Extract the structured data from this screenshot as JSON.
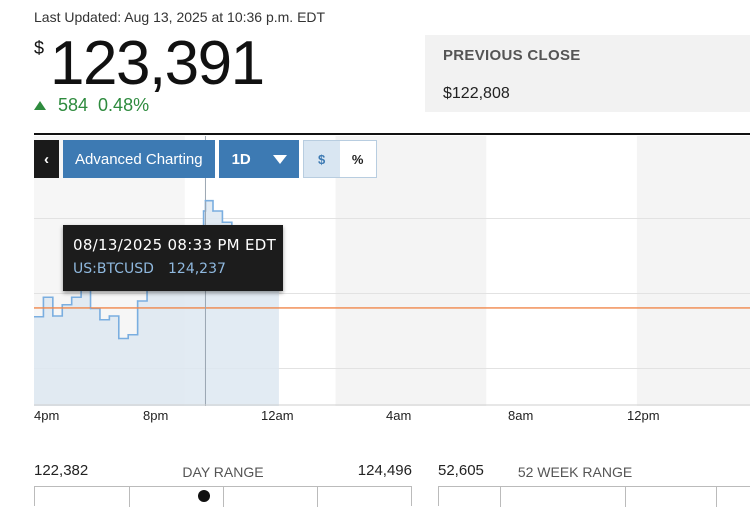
{
  "header": {
    "last_updated": "Last Updated: Aug 13, 2025 at 10:36 p.m. EDT",
    "currency_symbol": "$",
    "price": "123,391",
    "change": "584",
    "change_percent": "0.48%",
    "change_direction": "up",
    "change_color": "#2e8b3e"
  },
  "previous_close": {
    "label": "PREVIOUS CLOSE",
    "value": "$122,808"
  },
  "toolbar": {
    "back_icon": "chevron-left-icon",
    "back_glyph": "‹",
    "advanced_label": "Advanced Charting",
    "range_label": "1D",
    "dollar_label": "$",
    "percent_label": "%",
    "active_mode": "$",
    "accent_color": "#3d7ab3"
  },
  "tooltip": {
    "datetime": "08/13/2025 08:33 PM EDT",
    "symbol": "US:BTCUSD",
    "value": "124,237"
  },
  "chart_data": {
    "type": "area",
    "x_ticks": [
      "4pm",
      "8pm",
      "12am",
      "4am",
      "8am",
      "12pm"
    ],
    "series": [
      {
        "x": [
          "4:00 PM",
          "4:15 PM",
          "4:30 PM",
          "4:45 PM",
          "5:00 PM",
          "5:15 PM",
          "5:30 PM",
          "5:45 PM",
          "6:00 PM",
          "6:15 PM",
          "6:30 PM",
          "6:45 PM",
          "7:00 PM",
          "7:15 PM",
          "7:30 PM",
          "7:45 PM",
          "8:00 PM",
          "8:15 PM",
          "8:30 PM",
          "8:33 PM",
          "8:45 PM",
          "9:00 PM",
          "9:15 PM",
          "9:30 PM",
          "9:45 PM",
          "10:00 PM",
          "10:15 PM",
          "10:30 PM"
        ],
        "values": [
          122690,
          122950,
          122700,
          122850,
          122950,
          123050,
          122800,
          122650,
          122700,
          122400,
          122450,
          122900,
          123200,
          123350,
          123450,
          123350,
          123550,
          123800,
          124100,
          124237,
          124100,
          123950,
          123800,
          123700,
          123600,
          123550,
          123450,
          123391
        ]
      }
    ],
    "previous_close": 122808,
    "previous_close_color": "#f0864a",
    "line_color": "#7aaee0",
    "fill_color": "#dde7f1",
    "highlight_x": "8:33 PM",
    "ylim": [
      121500,
      125100
    ],
    "xlim_hours": [
      16,
      35
    ]
  },
  "day_range": {
    "low": "122,382",
    "label": "DAY RANGE",
    "high": "124,496",
    "position": 0.45
  },
  "week52_range": {
    "low": "52,605",
    "label": "52 WEEK RANGE"
  }
}
